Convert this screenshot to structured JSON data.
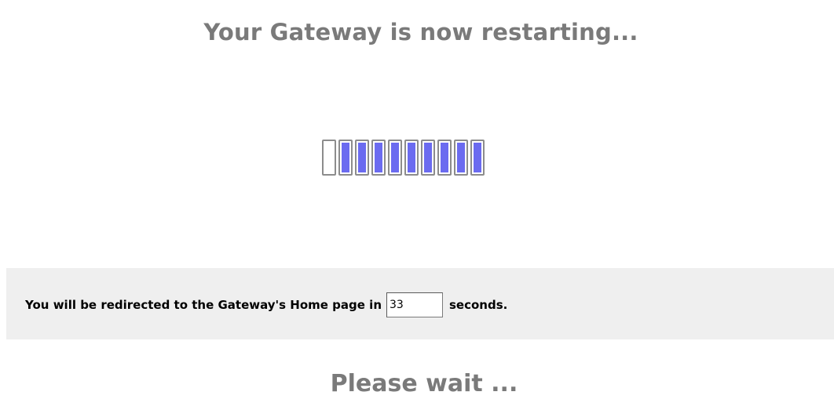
{
  "header": {
    "title": "Your Gateway is now restarting..."
  },
  "progress": {
    "segments_total": 10,
    "segments_filled": 9,
    "filled_fraction": 0.9,
    "fill_color": "#6b6bf0",
    "border_color": "#8c8c8c"
  },
  "redirect": {
    "text_before": "You will be redirected to the Gateway's Home page in",
    "countdown_value": "33",
    "text_after": "seconds."
  },
  "footer": {
    "wait_text": "Please wait ..."
  }
}
